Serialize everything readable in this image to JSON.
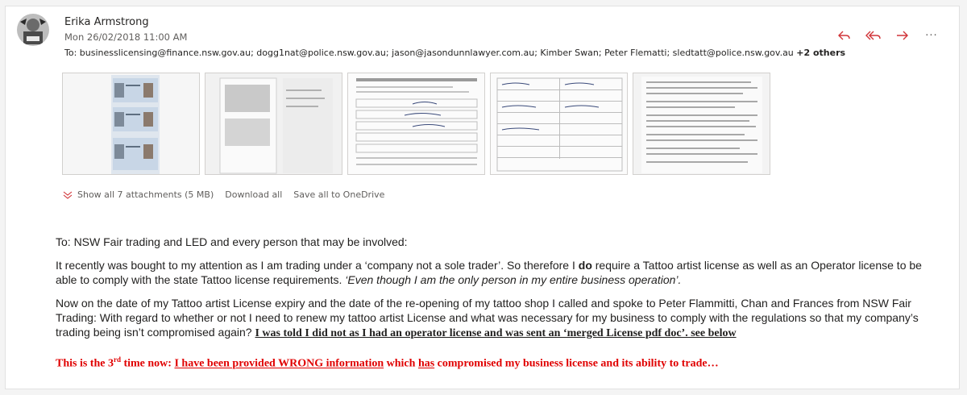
{
  "message": {
    "sender": "Erika Armstrong",
    "datetime": "Mon 26/02/2018 11:00 AM",
    "to_label": "To:",
    "recipients": "businesslicensing@finance.nsw.gov.au; dogg1nat@police.nsw.gov.au; jason@jasondunnlawyer.com.au; Kimber Swan; Peter Flematti; sledtatt@police.nsw.gov.au",
    "more_recipients": "+2 others"
  },
  "actions": {
    "reply": "reply-icon",
    "reply_all": "reply-all-icon",
    "forward": "forward-icon",
    "more": "···",
    "accent": "#d13438"
  },
  "attachments": {
    "show_all": "Show all 7 attachments (5 MB)",
    "download_all": "Download all",
    "save_onedrive": "Save all to OneDrive",
    "thumbnails": [
      "license-photos",
      "folded-document",
      "application-form",
      "form-page",
      "text-document"
    ]
  },
  "body": {
    "greeting": "To: NSW Fair trading and LED and every person that may be involved:",
    "p1_a": "It recently was bought to my attention as I am trading under a ‘company not a sole trader’. So therefore I ",
    "p1_bold": "do",
    "p1_b": " require a Tattoo artist license as well as an  Operator license to be able to comply with the state Tattoo license requirements. ",
    "p1_italic": "‘Even though I am the only person in my entire business operation’.",
    "p2_a": "Now on the date of my Tattoo artist License expiry and the date of the re-opening of my tattoo shop I called and spoke to Peter Flammitti, Chan and Frances from NSW Fair Trading: With regard to whether or not I need to renew my tattoo artist License and what was necessary for my business to comply with the regulations so that my company’s trading being isn’t compromised again? ",
    "p2_bold": "I was told I did not as I had an operator license and was sent an ‘merged License pdf doc’.  see below",
    "red_a": "This is the 3",
    "red_sup": "rd",
    "red_b": " time now:  ",
    "red_u1": "I have been provided WRONG information",
    "red_c": " which ",
    "red_u2": "has",
    "red_d": " compromised my business license and its ability to trade…"
  }
}
